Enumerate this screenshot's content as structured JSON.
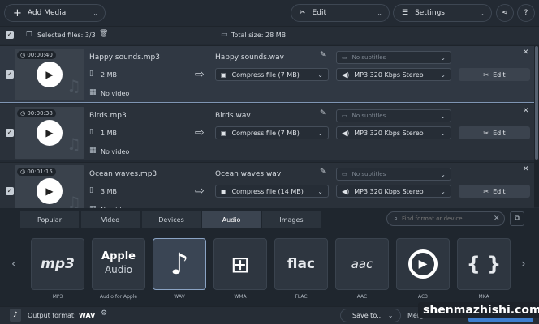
{
  "toolbar": {
    "add_media": "Add Media",
    "edit": "Edit",
    "settings": "Settings"
  },
  "summary": {
    "selected": "Selected files: 3/3",
    "total": "Total size: 28 MB"
  },
  "files": [
    {
      "duration": "00:00:40",
      "name": "Happy sounds.mp3",
      "size": "2 MB",
      "video": "No video",
      "output": "Happy sounds.wav",
      "compress": "Compress file (7 MB)",
      "subtitles": "No subtitles",
      "audio": "MP3 320 Kbps Stereo",
      "edit": "Edit"
    },
    {
      "duration": "00:00:38",
      "name": "Birds.mp3",
      "size": "1 MB",
      "video": "No video",
      "output": "Birds.wav",
      "compress": "Compress file (7 MB)",
      "subtitles": "No subtitles",
      "audio": "MP3 320 Kbps Stereo",
      "edit": "Edit"
    },
    {
      "duration": "00:01:15",
      "name": "Ocean waves.mp3",
      "size": "3 MB",
      "video": "No video",
      "output": "Ocean waves.wav",
      "compress": "Compress file (14 MB)",
      "subtitles": "No subtitles",
      "audio": "MP3 320 Kbps Stereo",
      "edit": "Edit"
    }
  ],
  "tabs": [
    "Popular",
    "Video",
    "Devices",
    "Audio",
    "Images"
  ],
  "active_tab": "Audio",
  "search": {
    "placeholder": "Find format or device..."
  },
  "formats": [
    {
      "label": "MP3",
      "icon": "mp3"
    },
    {
      "label": "Audio for Apple",
      "icon": "Apple Audio"
    },
    {
      "label": "WAV",
      "icon": "note"
    },
    {
      "label": "WMA",
      "icon": "windows"
    },
    {
      "label": "FLAC",
      "icon": "flac"
    },
    {
      "label": "AAC",
      "icon": "aac"
    },
    {
      "label": "AC3",
      "icon": "ac3"
    },
    {
      "label": "MKA",
      "icon": "{ }"
    }
  ],
  "bottom": {
    "output_label": "Output format:",
    "output_value": "WAV",
    "save_to": "Save to...",
    "merge": "Merge files",
    "convert": "Convert"
  },
  "watermark": "shenmazhishi.com",
  "colors": {
    "accent": "#4a90e2",
    "selected_outline": "#7f95b3"
  }
}
